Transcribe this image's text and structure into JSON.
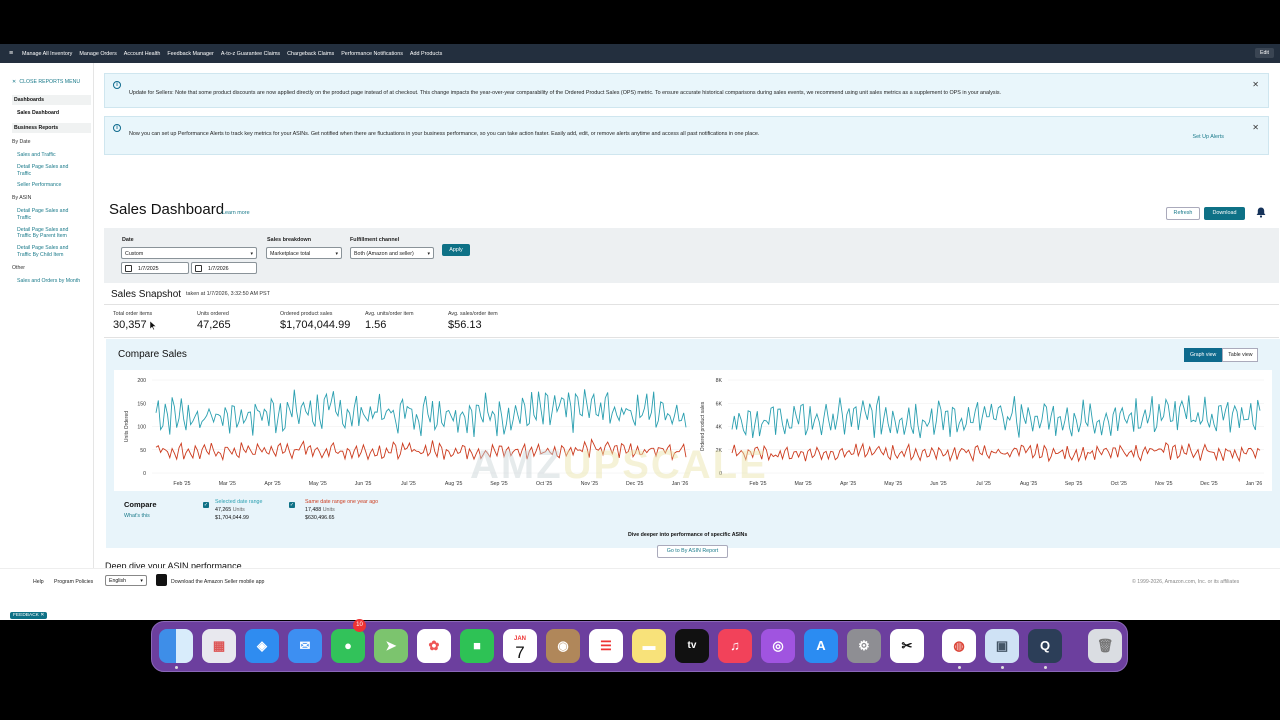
{
  "topnav": {
    "items": [
      "Manage All Inventory",
      "Manage Orders",
      "Account Health",
      "Feedback Manager",
      "A-to-z Guarantee Claims",
      "Chargeback Claims",
      "Performance Notifications",
      "Add Products"
    ],
    "edit_label": "Edit"
  },
  "sidebar": {
    "close_label": "CLOSE REPORTS MENU",
    "dashboards_head": "Dashboards",
    "sales_dashboard": "Sales Dashboard",
    "business_reports_head": "Business Reports",
    "by_date": "By Date",
    "by_date_links": [
      "Sales and Traffic",
      "Detail Page Sales and Traffic",
      "Seller Performance"
    ],
    "by_asin": "By ASIN",
    "by_asin_links": [
      "Detail Page Sales and Traffic",
      "Detail Page Sales and Traffic By Parent Item",
      "Detail Page Sales and Traffic By Child Item"
    ],
    "other": "Other",
    "other_links": [
      "Sales and Orders by Month"
    ]
  },
  "banners": {
    "update_text": "Update for Sellers: Note that some product discounts are now applied directly on the product page instead of at checkout. This change impacts the year-over-year comparability of the Ordered Product Sales (OPS) metric. To ensure accurate historical comparisons during sales events, we recommend using unit sales metrics as a supplement to OPS in your analysis.",
    "alerts_text": "Now you can set up Performance Alerts to track key metrics for your ASINs. Get notified when there are fluctuations in your business performance, so you can take action faster. Easily add, edit, or remove alerts anytime and access all past notifications in one place.",
    "alerts_action": "Set Up Alerts"
  },
  "header": {
    "title": "Sales Dashboard",
    "learn_more": "Learn more",
    "refresh": "Refresh",
    "download": "Download"
  },
  "filters": {
    "date_label": "Date",
    "date_value": "Custom",
    "start_date": "1/7/2025",
    "end_date": "1/7/2026",
    "breakdown_label": "Sales breakdown",
    "breakdown_value": "Marketplace total",
    "fulfillment_label": "Fulfillment channel",
    "fulfillment_value": "Both (Amazon and seller)",
    "apply": "Apply"
  },
  "snapshot": {
    "title": "Sales Snapshot",
    "taken": "taken at 1/7/2026, 3:32:50 AM PST",
    "metrics": [
      {
        "label": "Total order items",
        "value": "30,357"
      },
      {
        "label": "Units ordered",
        "value": "47,265"
      },
      {
        "label": "Ordered product sales",
        "value": "$1,704,044.99"
      },
      {
        "label": "Avg. units/order item",
        "value": "1.56"
      },
      {
        "label": "Avg. sales/order item",
        "value": "$56.13"
      }
    ]
  },
  "compare": {
    "title": "Compare Sales",
    "graph_view": "Graph view",
    "table_view": "Table view",
    "compare_label": "Compare",
    "whats_this": "What's this",
    "selected_label": "Selected date range",
    "selected_units": "47,265",
    "units_word": "Units",
    "selected_sales": "$1,704,044.99",
    "prior_label": "Same date range one year ago",
    "prior_units": "17,488",
    "prior_sales": "$630,496.65",
    "colors": {
      "current": "#2a9fb0",
      "prior": "#cc3b1e"
    }
  },
  "chart_data": [
    {
      "type": "line",
      "ylabel": "Units Ordered",
      "x": [
        "Feb '25",
        "Mar '25",
        "Apr '25",
        "May '25",
        "Jun '25",
        "Jul '25",
        "Aug '25",
        "Sep '25",
        "Oct '25",
        "Nov '25",
        "Dec '25",
        "Jan '26"
      ],
      "yticks": [
        0,
        50,
        100,
        150,
        200
      ],
      "ylim": [
        0,
        200
      ],
      "series": [
        {
          "name": "Selected date range",
          "values": [
            130,
            120,
            125,
            135,
            130,
            128,
            132,
            125,
            130,
            140,
            135,
            130
          ]
        },
        {
          "name": "Same date range one year ago",
          "values": [
            50,
            45,
            48,
            50,
            47,
            48,
            50,
            46,
            48,
            52,
            50,
            48
          ]
        }
      ]
    },
    {
      "type": "line",
      "ylabel": "Ordered product sales",
      "x": [
        "Feb '25",
        "Mar '25",
        "Apr '25",
        "May '25",
        "Jun '25",
        "Jul '25",
        "Aug '25",
        "Sep '25",
        "Oct '25",
        "Nov '25",
        "Dec '25",
        "Jan '26"
      ],
      "yticks": [
        "0",
        "2K",
        "4K",
        "6K",
        "8K"
      ],
      "ylim": [
        0,
        8000
      ],
      "series": [
        {
          "name": "Selected date range",
          "values": [
            4700,
            4500,
            4600,
            4900,
            4700,
            4650,
            4800,
            4600,
            4750,
            5000,
            4900,
            4800
          ]
        },
        {
          "name": "Same date range one year ago",
          "values": [
            1800,
            1650,
            1750,
            1800,
            1700,
            1750,
            1800,
            1700,
            1750,
            1900,
            1800,
            1750
          ]
        }
      ]
    }
  ],
  "deep_dive": {
    "title": "Deep dive your ASIN performance",
    "subtitle": "Dive deeper into performance of specific ASINs",
    "button": "Go to By ASIN Report"
  },
  "footer": {
    "help": "Help",
    "policies": "Program Policies",
    "language": "English",
    "mobile_app": "Download the Amazon Seller mobile app",
    "copyright": "© 1999-2026, Amazon.com, Inc. or its affiliates",
    "feedback": "FEEDBACK"
  },
  "watermark": {
    "part1": "AMZ",
    "part2": "UPSCALE"
  },
  "dock": {
    "calendar_month": "JAN",
    "calendar_day": "7",
    "messages_badge": "10",
    "apps": [
      "finder-icon",
      "launchpad-icon",
      "safari-icon",
      "mail-icon",
      "messages-icon",
      "maps-icon",
      "photos-icon",
      "facetime-icon",
      "calendar-icon",
      "contacts-icon",
      "reminders-icon",
      "notes-icon",
      "tv-icon",
      "music-icon",
      "podcasts-icon",
      "appstore-icon",
      "settings-icon",
      "capcut-icon",
      "chrome-icon",
      "preview-icon",
      "quicktime-icon",
      "trash-icon"
    ]
  }
}
